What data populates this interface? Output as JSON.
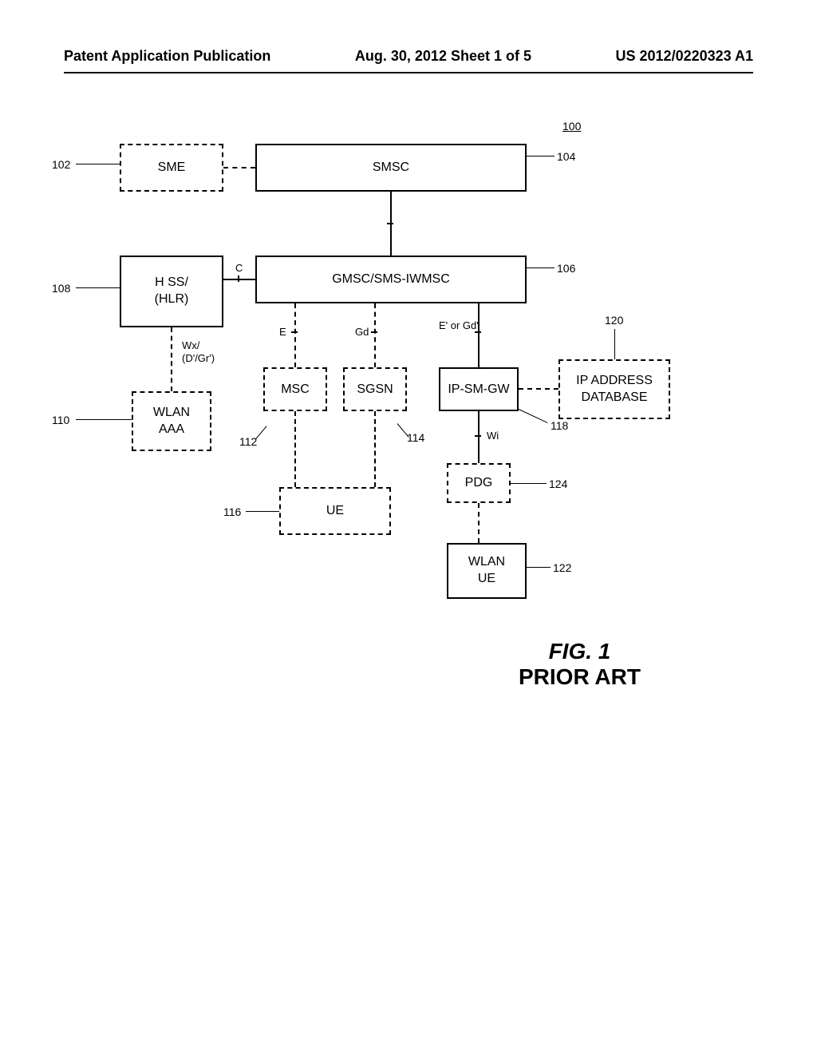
{
  "header": {
    "left": "Patent Application Publication",
    "center": "Aug. 30, 2012  Sheet 1 of 5",
    "right": "US 2012/0220323 A1"
  },
  "nodes": {
    "sme": "SME",
    "smsc": "SMSC",
    "gmsc": "GMSC/SMS-IWMSC",
    "hss": "H SS/\n(HLR)",
    "wlan_aaa": "WLAN\nAAA",
    "msc": "MSC",
    "sgsn": "SGSN",
    "ue": "UE",
    "ip_sm_gw": "IP-SM-GW",
    "pdg": "PDG",
    "wlan_ue": "WLAN\nUE",
    "ip_db": "IP ADDRESS\nDATABASE"
  },
  "refs": {
    "r100": "100",
    "r102": "102",
    "r104": "104",
    "r106": "106",
    "r108": "108",
    "r110": "110",
    "r112": "112",
    "r114": "114",
    "r116": "116",
    "r118": "118",
    "r120": "120",
    "r122": "122",
    "r124": "124"
  },
  "interfaces": {
    "c": "C",
    "e": "E",
    "gd": "Gd",
    "e_gd": "E' or Gd'",
    "wx": "Wx/\n(D'/Gr')",
    "wi": "Wi"
  },
  "caption": {
    "fig": "FIG. 1",
    "prior": "PRIOR ART"
  },
  "chart_data": {
    "type": "diagram",
    "title": "FIG. 1 PRIOR ART",
    "system_ref": "100",
    "nodes": [
      {
        "id": "SME",
        "ref": "102",
        "style": "dashed"
      },
      {
        "id": "SMSC",
        "ref": "104",
        "style": "solid"
      },
      {
        "id": "GMSC/SMS-IWMSC",
        "ref": "106",
        "style": "solid"
      },
      {
        "id": "HSS/(HLR)",
        "ref": "108",
        "style": "solid"
      },
      {
        "id": "WLAN AAA",
        "ref": "110",
        "style": "dashed"
      },
      {
        "id": "MSC",
        "ref": "112",
        "style": "dashed"
      },
      {
        "id": "SGSN",
        "ref": "114",
        "style": "dashed"
      },
      {
        "id": "UE",
        "ref": "116",
        "style": "dashed"
      },
      {
        "id": "IP-SM-GW",
        "ref": "118",
        "style": "solid"
      },
      {
        "id": "IP ADDRESS DATABASE",
        "ref": "120",
        "style": "dashed"
      },
      {
        "id": "WLAN UE",
        "ref": "122",
        "style": "solid"
      },
      {
        "id": "PDG",
        "ref": "124",
        "style": "dashed"
      }
    ],
    "edges": [
      {
        "from": "SME",
        "to": "SMSC",
        "style": "dashed"
      },
      {
        "from": "SMSC",
        "to": "GMSC/SMS-IWMSC",
        "style": "solid"
      },
      {
        "from": "GMSC/SMS-IWMSC",
        "to": "HSS/(HLR)",
        "label": "C",
        "style": "solid"
      },
      {
        "from": "GMSC/SMS-IWMSC",
        "to": "MSC",
        "label": "E",
        "style": "dashed"
      },
      {
        "from": "GMSC/SMS-IWMSC",
        "to": "SGSN",
        "label": "Gd",
        "style": "dashed"
      },
      {
        "from": "GMSC/SMS-IWMSC",
        "to": "IP-SM-GW",
        "label": "E' or Gd'",
        "style": "solid"
      },
      {
        "from": "HSS/(HLR)",
        "to": "WLAN AAA",
        "label": "Wx/(D'/Gr')",
        "style": "dashed"
      },
      {
        "from": "MSC",
        "to": "UE",
        "style": "dashed"
      },
      {
        "from": "SGSN",
        "to": "UE",
        "style": "dashed"
      },
      {
        "from": "IP-SM-GW",
        "to": "IP ADDRESS DATABASE",
        "style": "dashed"
      },
      {
        "from": "IP-SM-GW",
        "to": "PDG",
        "label": "Wi",
        "style": "solid"
      },
      {
        "from": "PDG",
        "to": "WLAN UE",
        "style": "dashed"
      }
    ]
  }
}
